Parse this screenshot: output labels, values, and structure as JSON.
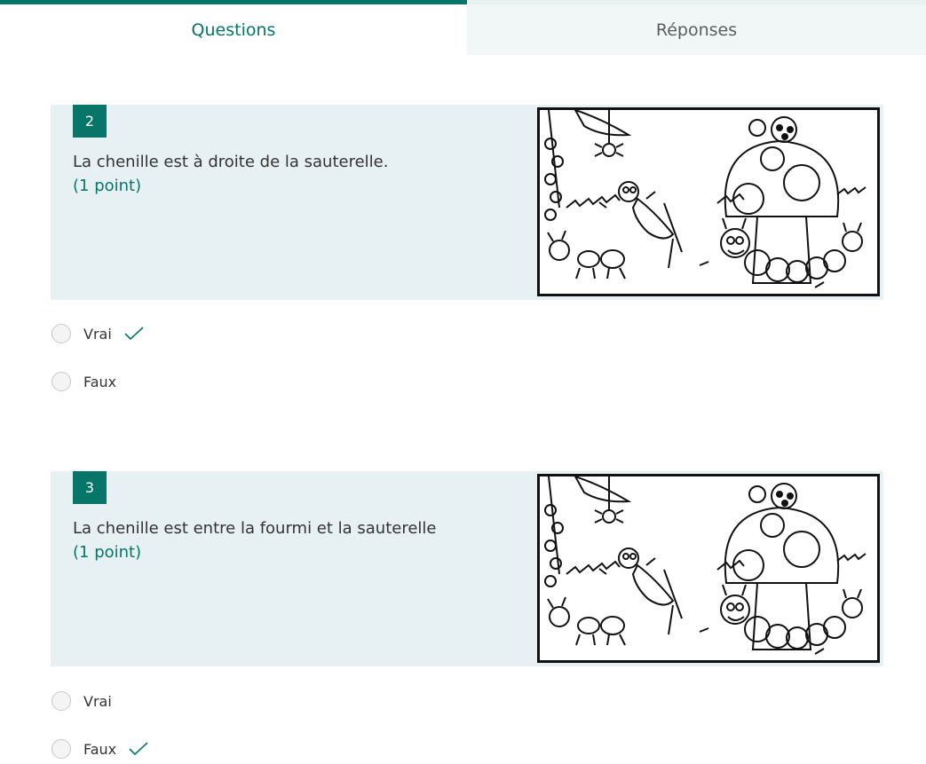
{
  "tabs": {
    "questions_label": "Questions",
    "responses_label": "Réponses"
  },
  "questions": [
    {
      "number": "2",
      "text": "La chenille est à droite de la sauterelle.",
      "points": "(1 point)",
      "options": [
        {
          "label": "Vrai",
          "correct": true
        },
        {
          "label": "Faux",
          "correct": false
        }
      ]
    },
    {
      "number": "3",
      "text": "La chenille est entre la fourmi et la sauterelle",
      "points": "(1 point)",
      "options": [
        {
          "label": "Vrai",
          "correct": false
        },
        {
          "label": "Faux",
          "correct": true
        }
      ]
    }
  ],
  "colors": {
    "accent": "#077568",
    "card_background": "#e7f0f2",
    "check": "#077568"
  },
  "icons": {
    "correct": "checkmark-icon"
  }
}
